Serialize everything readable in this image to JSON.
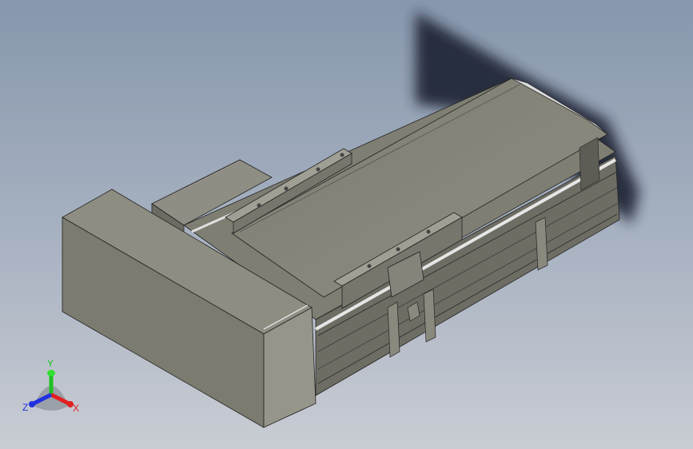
{
  "viewport": {
    "background_top": "#8797ad",
    "background_bottom": "#c9ccd3",
    "model_color": "#8a8a7a"
  },
  "triad": {
    "x_label": "X",
    "y_label": "Y",
    "z_label": "Z",
    "x_color": "#e02020",
    "y_color": "#20c020",
    "z_color": "#2030e0"
  }
}
